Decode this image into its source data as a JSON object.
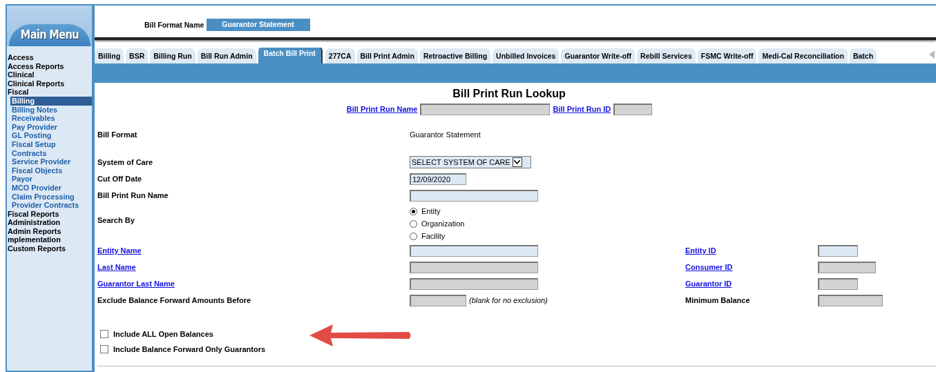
{
  "sidebar": {
    "title": "Main Menu",
    "items": [
      {
        "label": "Access",
        "selected": false
      },
      {
        "label": "Access Reports",
        "selected": false
      },
      {
        "label": "Clinical",
        "selected": false
      },
      {
        "label": "Clinical Reports",
        "selected": false
      },
      {
        "label": "Fiscal",
        "selected": false,
        "children": [
          {
            "label": "Billing",
            "selected": true
          },
          {
            "label": "Billing Notes",
            "selected": false
          },
          {
            "label": "Receivables",
            "selected": false
          },
          {
            "label": "Pay Provider",
            "selected": false
          },
          {
            "label": "GL Posting",
            "selected": false
          },
          {
            "label": "Fiscal Setup",
            "selected": false
          },
          {
            "label": "Contracts",
            "selected": false
          },
          {
            "label": "Service Provider",
            "selected": false
          },
          {
            "label": "Fiscal Objects",
            "selected": false
          },
          {
            "label": "Payor",
            "selected": false
          },
          {
            "label": "MCO Provider",
            "selected": false
          },
          {
            "label": "Claim Processing",
            "selected": false
          },
          {
            "label": "Provider Contracts",
            "selected": false
          }
        ]
      },
      {
        "label": "Fiscal Reports",
        "selected": false
      },
      {
        "label": "Administration",
        "selected": false
      },
      {
        "label": "Admin Reports",
        "selected": false
      },
      {
        "label": "mplementation",
        "selected": false
      },
      {
        "label": "Custom Reports",
        "selected": false
      }
    ]
  },
  "header": {
    "label": "Bill Format Name",
    "value": "Guarantor Statement"
  },
  "tabs": [
    {
      "label": "Billing",
      "selected": false
    },
    {
      "label": "BSR",
      "selected": false
    },
    {
      "label": "Billing Run",
      "selected": false
    },
    {
      "label": "Bill Run Admin",
      "selected": false
    },
    {
      "label": "Batch Bill Print",
      "selected": true
    },
    {
      "label": "277CA",
      "selected": false
    },
    {
      "label": "Bill Print Admin",
      "selected": false
    },
    {
      "label": "Retroactive Billing",
      "selected": false
    },
    {
      "label": "Unbilled Invoices",
      "selected": false
    },
    {
      "label": "Guarantor Write-off",
      "selected": false
    },
    {
      "label": "Rebill Services",
      "selected": false
    },
    {
      "label": "FSMC Write-off",
      "selected": false
    },
    {
      "label": "Medi-Cal Reconciliation",
      "selected": false
    },
    {
      "label": "Batch",
      "selected": false
    }
  ],
  "lookup": {
    "title": "Bill Print Run Lookup",
    "fields": [
      {
        "label": "Bill Print Run Name",
        "disabled": true
      },
      {
        "label": "Bill Print Run ID",
        "disabled": true
      }
    ]
  },
  "form": [
    {
      "kind": "static",
      "label": "Bill Format",
      "link": false,
      "value": "Guarantor Statement"
    },
    {
      "kind": "select",
      "label": "System of Care",
      "link": false,
      "value": "SELECT SYSTEM OF CARE"
    },
    {
      "kind": "date",
      "label": "Cut Off Date",
      "link": false,
      "value": "12/09/2020",
      "disabled": false
    },
    {
      "kind": "text",
      "label": "Bill Print Run Name",
      "link": false,
      "disabled": false
    },
    {
      "kind": "radio",
      "label": "Search By",
      "link": false,
      "options": [
        {
          "label": "Entity",
          "selected": true
        },
        {
          "label": "Organization",
          "selected": false
        },
        {
          "label": "Facility",
          "selected": false
        }
      ]
    },
    {
      "kind": "text",
      "label": "Entity Name",
      "link": true,
      "disabled": false,
      "right": {
        "label": "Entity ID",
        "link": true,
        "disabled": false
      }
    },
    {
      "kind": "text",
      "label": "Last Name",
      "link": true,
      "disabled": true,
      "right": {
        "label": "Consumer ID",
        "link": true,
        "disabled": true
      }
    },
    {
      "kind": "text",
      "label": "Guarantor Last Name",
      "link": true,
      "disabled": true,
      "right": {
        "label": "Guarantor ID",
        "link": true,
        "disabled": true
      }
    },
    {
      "kind": "date",
      "label": "Exclude Balance Forward Amounts Before",
      "link": false,
      "disabled": true,
      "note": "(blank for no exclusion)",
      "right": {
        "label": "Minimum Balance",
        "link": false,
        "disabled": true
      }
    }
  ],
  "checkboxes": [
    {
      "label": "Include ALL Open Balances",
      "checked": false
    },
    {
      "label": "Include Balance Forward Only Guarantors",
      "checked": false
    }
  ]
}
